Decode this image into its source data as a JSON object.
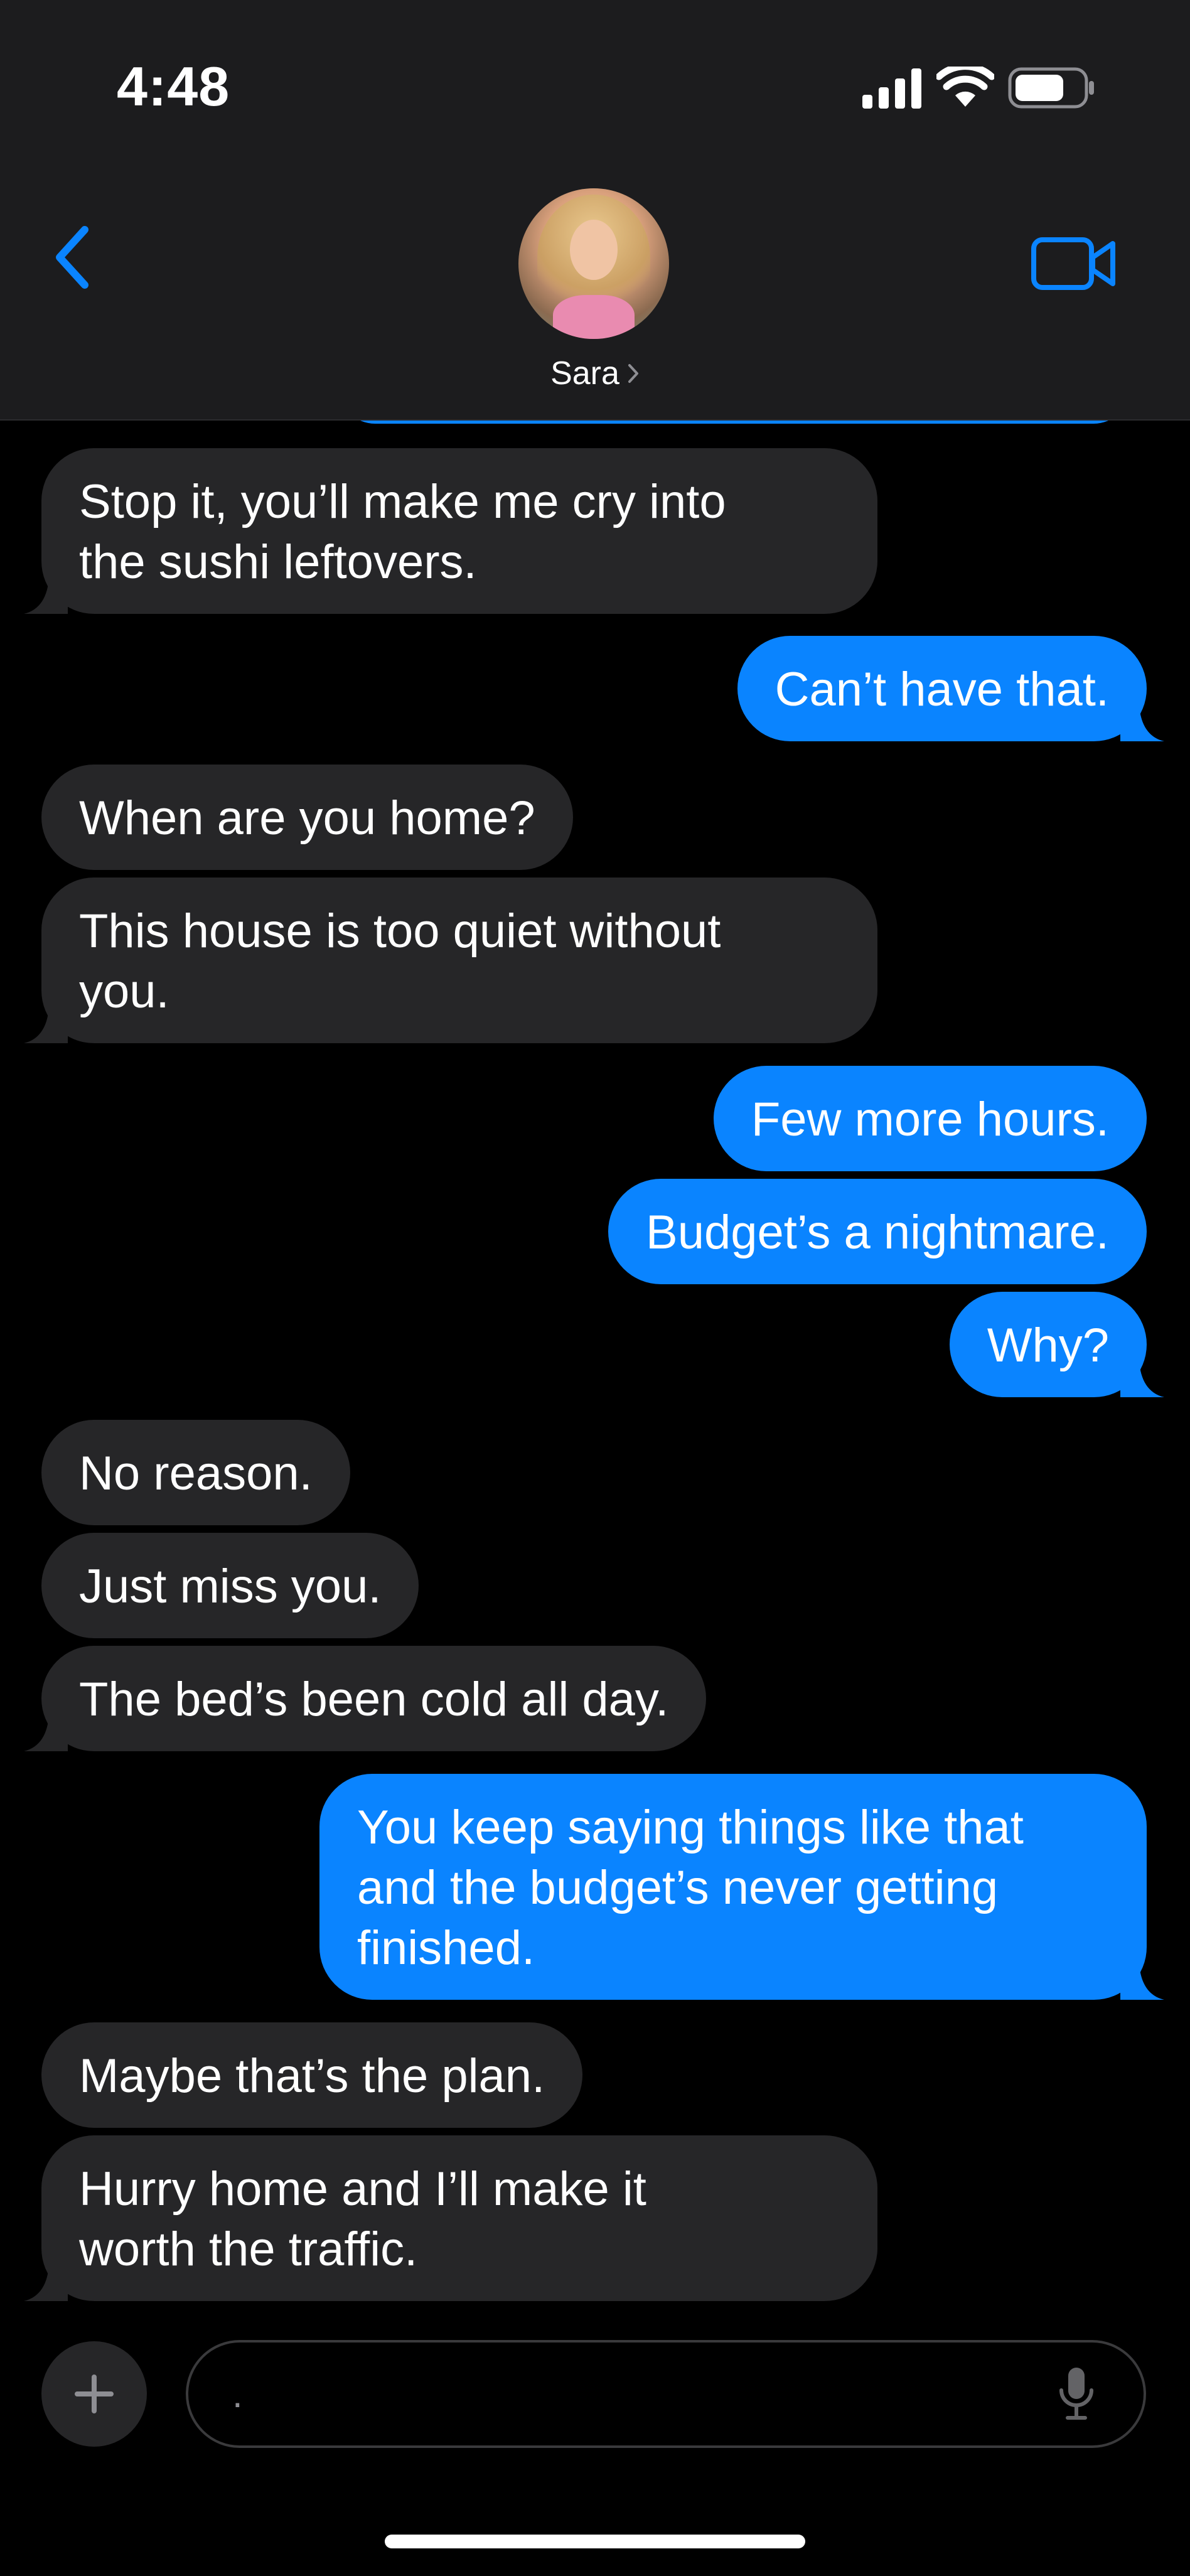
{
  "status_bar": {
    "time": "4:48"
  },
  "header": {
    "contact_name": "Sara"
  },
  "messages": [
    {
      "side": "in",
      "text": "Stop it, you’ll make me cry into\nthe sushi leftovers.",
      "tail": true
    },
    {
      "side": "out",
      "text": "Can’t have that.",
      "tail": true
    },
    {
      "side": "in",
      "text": "When are you home?",
      "tail": false
    },
    {
      "side": "in",
      "text": "This house is too quiet without\nyou.",
      "tail": true
    },
    {
      "side": "out",
      "text": "Few more hours.",
      "tail": false
    },
    {
      "side": "out",
      "text": "Budget’s a nightmare.",
      "tail": false
    },
    {
      "side": "out",
      "text": "Why?",
      "tail": true
    },
    {
      "side": "in",
      "text": "No reason.",
      "tail": false
    },
    {
      "side": "in",
      "text": "Just miss you.",
      "tail": false
    },
    {
      "side": "in",
      "text": "The bed’s been cold all day.",
      "tail": true
    },
    {
      "side": "out",
      "text": "You keep saying things like that\nand the budget’s never getting\nfinished.",
      "tail": true
    },
    {
      "side": "in",
      "text": "Maybe that’s the plan.",
      "tail": false
    },
    {
      "side": "in",
      "text": "Hurry home and I’ll make it\nworth the traffic.",
      "tail": true
    }
  ],
  "composer": {
    "value": ".",
    "placeholder": ""
  },
  "colors": {
    "outgoing": "#0a84ff",
    "incoming": "#262628",
    "accent": "#0a84ff",
    "header_bg": "#1c1c1e"
  },
  "icons": {
    "back": "chevron-left-icon",
    "facetime": "video-camera-icon",
    "signal": "cellular-signal-icon",
    "wifi": "wifi-icon",
    "battery": "battery-icon",
    "plus": "plus-icon",
    "mic": "microphone-icon",
    "disclosure": "chevron-right-icon"
  }
}
